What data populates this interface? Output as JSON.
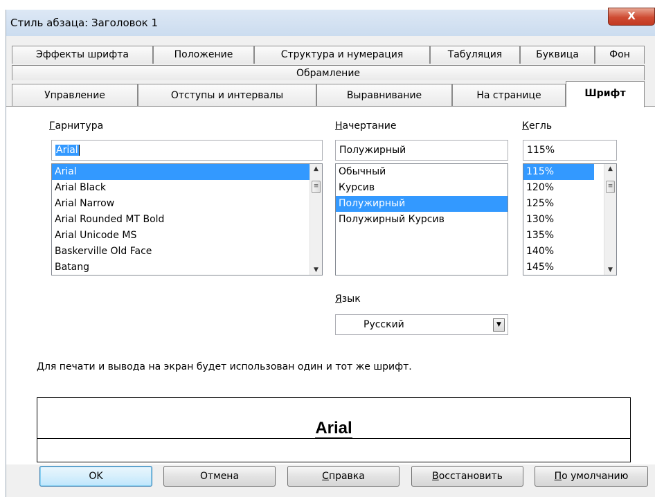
{
  "window": {
    "title": "Стиль абзаца: Заголовок 1",
    "close_label": "X"
  },
  "tabs_row1": [
    {
      "label": "Эффекты шрифта"
    },
    {
      "label": "Положение"
    },
    {
      "label": "Структура и нумерация"
    },
    {
      "label": "Табуляция"
    },
    {
      "label": "Буквица"
    },
    {
      "label": "Фон"
    }
  ],
  "tabs_row2": [
    {
      "label": "Обрамление"
    }
  ],
  "tabs_row3": [
    {
      "label": "Управление"
    },
    {
      "label": "Отступы и интервалы"
    },
    {
      "label": "Выравнивание"
    },
    {
      "label": "На странице"
    },
    {
      "label": "Шрифт",
      "active": true
    }
  ],
  "font": {
    "family_label_first": "Г",
    "family_label_rest": "арнитура",
    "family_value": "Arial",
    "family_list": [
      "Arial",
      "Arial Black",
      "Arial Narrow",
      "Arial Rounded MT Bold",
      "Arial Unicode MS",
      "Baskerville Old Face",
      "Batang"
    ],
    "style_label_first": "Н",
    "style_label_rest": "ачертание",
    "style_value": "Полужирный",
    "style_list": [
      "Обычный",
      "Курсив",
      "Полужирный",
      "Полужирный Курсив"
    ],
    "size_label_first": "К",
    "size_label_rest": "егль",
    "size_value": "115%",
    "size_list": [
      "115%",
      "120%",
      "125%",
      "130%",
      "135%",
      "140%",
      "145%"
    ],
    "language_label_first": "Я",
    "language_label_rest": "зык",
    "language_value": "Русский"
  },
  "info_text": "Для печати и вывода на экран будет использован один и тот же шрифт.",
  "preview_text": "Arial",
  "buttons": {
    "ok": "OK",
    "cancel": "Отмена",
    "help_first": "С",
    "help_rest": "правка",
    "reset_first": "В",
    "reset_rest": "осстановить",
    "default_first": "П",
    "default_rest": "о умолчанию"
  }
}
